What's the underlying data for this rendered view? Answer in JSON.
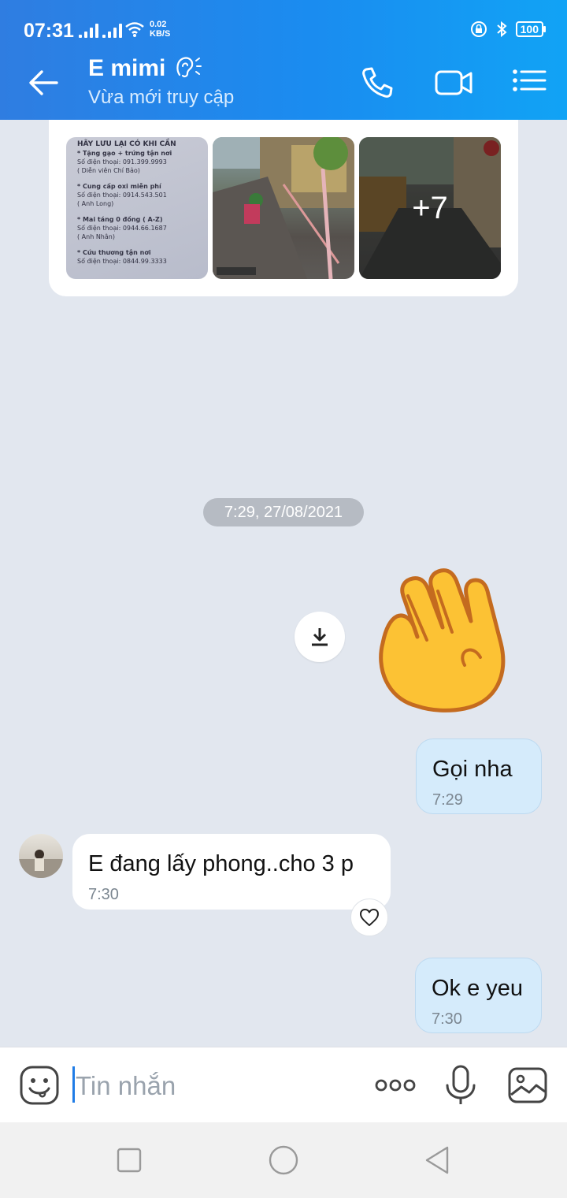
{
  "status_bar": {
    "time": "07:31",
    "net_speed_value": "0.02",
    "net_speed_unit": "KB/S",
    "battery": "100"
  },
  "header": {
    "contact_name": "E mimi",
    "presence": "Vừa mới truy cập",
    "back_icon": "arrow-left-icon",
    "call_icon": "phone-icon",
    "video_icon": "video-camera-icon",
    "menu_icon": "list-menu-icon"
  },
  "chat": {
    "image_group": {
      "photo1_lines": [
        "HÃY LƯU LẠI CÓ KHI CẦN",
        "* Tặng gạo + trứng tận nơi",
        "Số điện thoại: 091.399.9993",
        "( Diễn viên Chí Bảo)",
        "* Cung cấp oxi miễn phí",
        "Số điện thoại: 0914.543.501",
        "( Anh Long)",
        "* Mai táng 0 đồng ( A-Z)",
        "Số điện thoại: 0944.66.1687",
        "( Anh Nhân)",
        "* Cứu thương tận nơi",
        "Số điện thoại: 0844.99.3333"
      ],
      "more_count": "+7"
    },
    "date_separator": "7:29, 27/08/2021",
    "messages": [
      {
        "direction": "out",
        "text": "Gọi nha",
        "time": "7:29"
      },
      {
        "direction": "in",
        "text": "E đang lấy phong..cho 3 p",
        "time": "7:30"
      },
      {
        "direction": "out",
        "text": "Ok e yeu",
        "time": "7:30"
      }
    ]
  },
  "composer": {
    "placeholder": "Tin nhắn",
    "sticker_icon": "emoji-face-icon",
    "more_icon": "more-dots-icon",
    "mic_icon": "microphone-icon",
    "image_icon": "image-gallery-icon"
  },
  "colors": {
    "header_start": "#2f7de1",
    "header_end": "#11a3f5",
    "chat_background": "#e2e7ef",
    "outgoing_bubble": "#d5ebfb",
    "accent": "#1f7ce6"
  }
}
